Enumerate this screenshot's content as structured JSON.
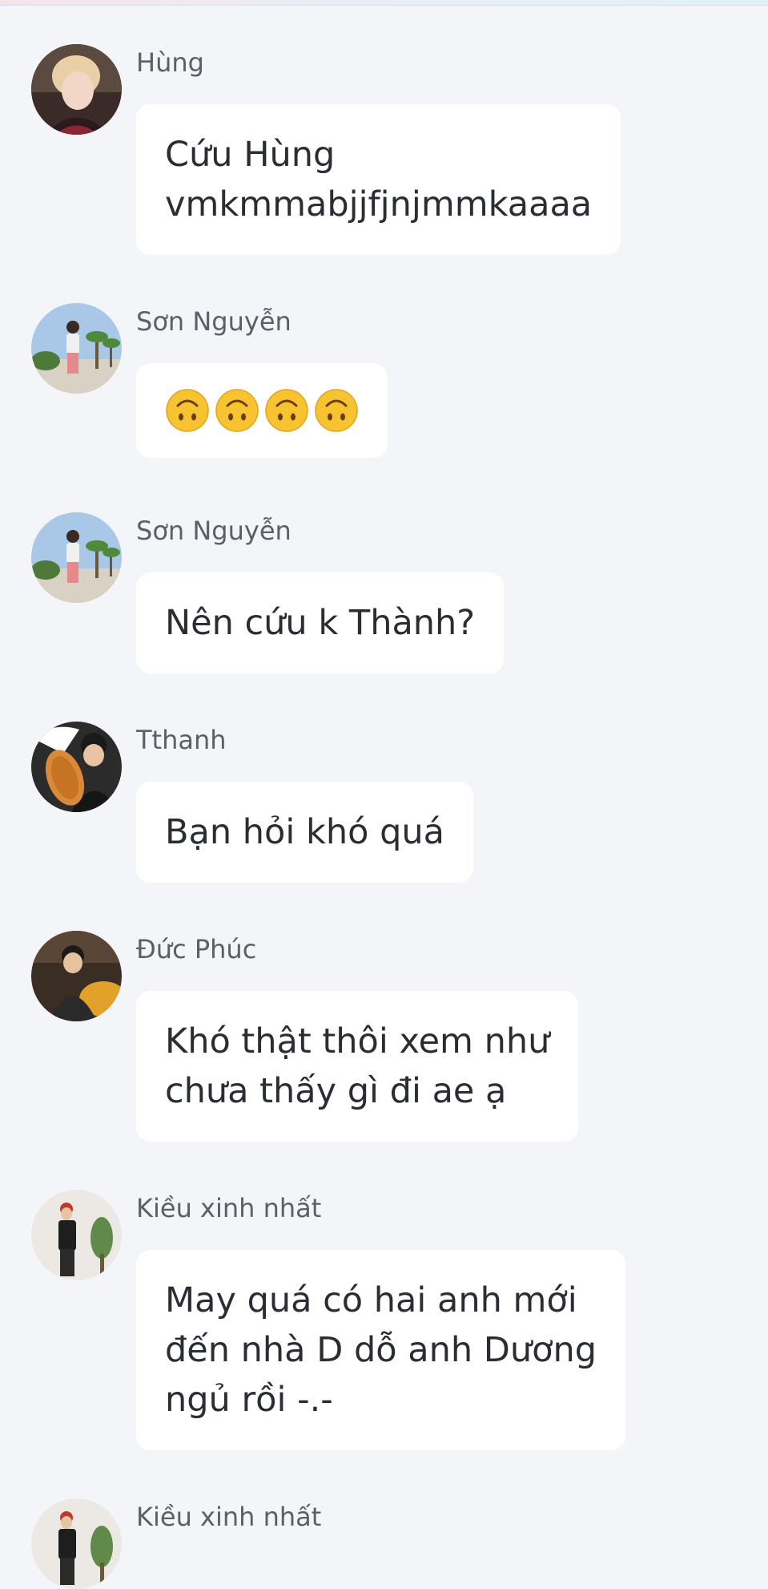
{
  "messages": [
    {
      "sender": "Hùng",
      "lines": [
        "Cứu Hùng",
        "vmkmmabjjfjnjmmkaaaa"
      ],
      "avatar": "avatar-hung"
    },
    {
      "sender": "Sơn Nguyễn",
      "emojis": [
        "upside-down-face-icon",
        "upside-down-face-icon",
        "upside-down-face-icon",
        "upside-down-face-icon"
      ],
      "avatar": "avatar-son"
    },
    {
      "sender": "Sơn Nguyễn",
      "lines": [
        "Nên cứu k Thành?"
      ],
      "avatar": "avatar-son"
    },
    {
      "sender": "Tthanh",
      "lines": [
        "Bạn hỏi khó quá"
      ],
      "avatar": "avatar-tthanh"
    },
    {
      "sender": "Đức Phúc",
      "lines": [
        "Khó thật thôi xem như",
        "chưa thấy gì đi ae ạ"
      ],
      "avatar": "avatar-duc-phuc"
    },
    {
      "sender": "Kiều xinh nhất",
      "lines": [
        "May quá có hai anh mới",
        "đến nhà D dỗ anh Dương",
        "ngủ rồi -.-"
      ],
      "avatar": "avatar-kieu"
    },
    {
      "sender": "Kiều xinh nhất",
      "lines": [],
      "avatar": "avatar-kieu"
    }
  ],
  "colors": {
    "background": "#f4f5f8",
    "bubble": "#ffffff",
    "sender_text": "#5b5f66",
    "message_text": "#2a2d33",
    "emoji_face": "#f7c331"
  }
}
